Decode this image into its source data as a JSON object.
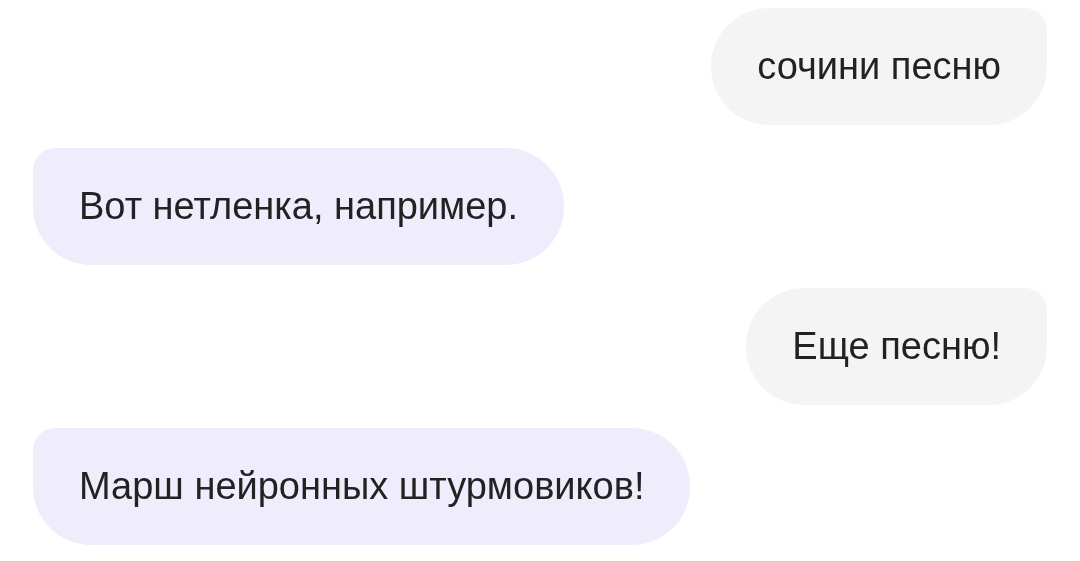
{
  "messages": [
    {
      "kind": "user",
      "text": "сочини песню"
    },
    {
      "kind": "bot",
      "text": "Вот нетленка, например."
    },
    {
      "kind": "user",
      "text": "Еще песню!"
    },
    {
      "kind": "bot",
      "text": "Марш нейронных штурмовиков!"
    }
  ]
}
